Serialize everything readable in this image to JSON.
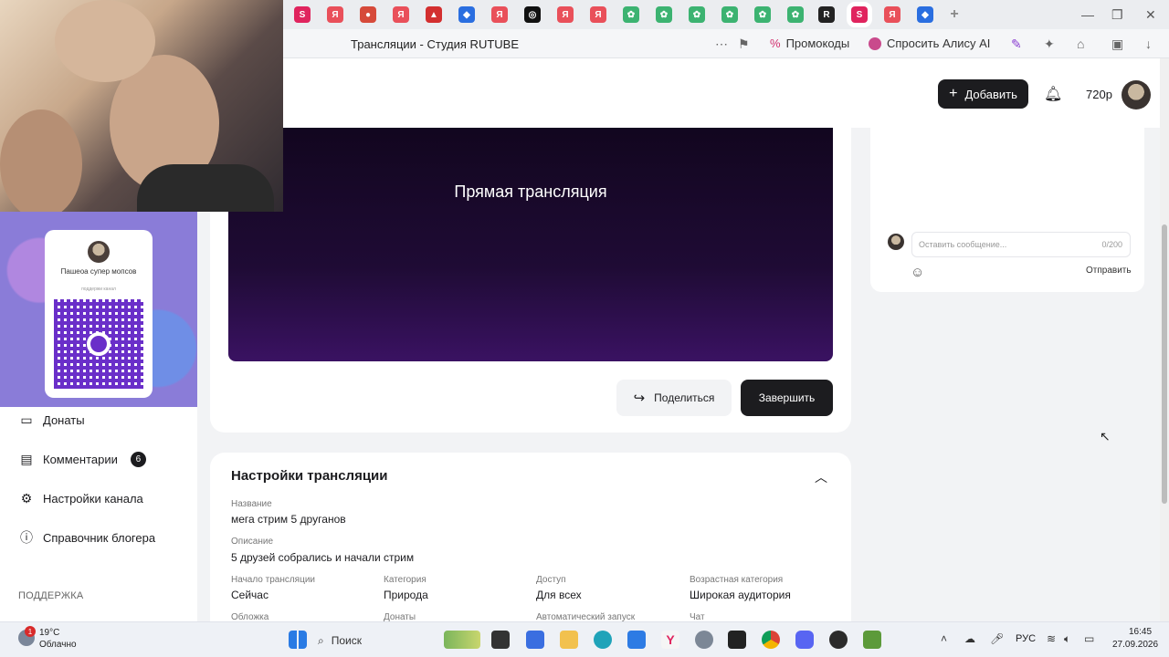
{
  "browser": {
    "tab_title": "Трансляции - Студия RUTUBE",
    "promo_label": "Промокоды",
    "alice_label": "Спросить Алису AI"
  },
  "header": {
    "add_label": "Добавить",
    "balance": "720р"
  },
  "donation_widget": {
    "channel_name": "Пашеоа супер мопсов",
    "subtitle": "поддержи канал"
  },
  "sidebar": {
    "items": [
      {
        "label": "Донаты",
        "icon": "wallet-icon"
      },
      {
        "label": "Комментарии",
        "icon": "comment-icon",
        "badge": "6"
      },
      {
        "label": "Настройки канала",
        "icon": "gear-icon"
      },
      {
        "label": "Справочник блогера",
        "icon": "info-icon"
      }
    ],
    "support_label": "ПОДДЕРЖКА"
  },
  "player": {
    "title": "Прямая трансляция"
  },
  "actions": {
    "share_label": "Поделиться",
    "end_label": "Завершить"
  },
  "chat": {
    "placeholder": "Оставить сообщение...",
    "counter": "0/200",
    "send_label": "Отправить"
  },
  "settings": {
    "title": "Настройки трансляции",
    "name_label": "Название",
    "name_value": "мега стрим 5 дрyганов",
    "desc_label": "Описание",
    "desc_value": "5 друзей собрались и начали стрим",
    "fields": [
      {
        "label": "Начало трансляции",
        "value": "Сейчас"
      },
      {
        "label": "Категория",
        "value": "Природа"
      },
      {
        "label": "Доступ",
        "value": "Для всех"
      },
      {
        "label": "Возрастная категория",
        "value": "Широкая аудитория"
      }
    ],
    "next_labels": [
      "Обложка",
      "Донаты",
      "Автоматический запуск",
      "Чат"
    ]
  },
  "taskbar": {
    "weather_badge": "1",
    "temperature": "19°C",
    "weather": "Облачно",
    "search_label": "Поиск",
    "language": "РУС",
    "time": "16:45",
    "date": "27.09.2026"
  },
  "colors": {
    "accent": "#1c1c1f",
    "player_bg": "#1f0b35",
    "qr": "#6a2fc9"
  }
}
